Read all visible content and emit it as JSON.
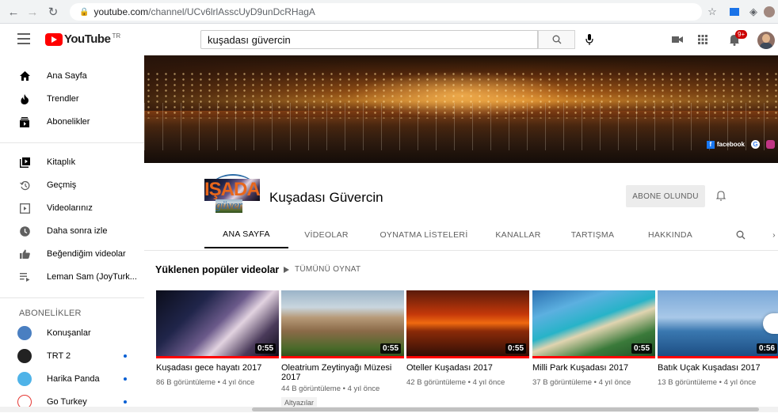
{
  "browser": {
    "url_host": "youtube.com",
    "url_path": "/channel/UCv6lrlAsscUyD9unDcRHagA"
  },
  "header": {
    "logo_text": "YouTube",
    "logo_region": "TR",
    "search_value": "kuşadası güvercin",
    "notification_count": "9+"
  },
  "sidebar": {
    "main_items": [
      {
        "label": "Ana Sayfa",
        "icon": "home-icon"
      },
      {
        "label": "Trendler",
        "icon": "fire-icon"
      },
      {
        "label": "Abonelikler",
        "icon": "subscriptions-icon"
      }
    ],
    "library_items": [
      {
        "label": "Kitaplık",
        "icon": "library-icon"
      },
      {
        "label": "Geçmiş",
        "icon": "history-icon"
      },
      {
        "label": "Videolarınız",
        "icon": "your-videos-icon"
      },
      {
        "label": "Daha sonra izle",
        "icon": "watch-later-icon"
      },
      {
        "label": "Beğendiğim videolar",
        "icon": "liked-icon"
      },
      {
        "label": "Leman Sam (JoyTurk...",
        "icon": "playlist-icon"
      }
    ],
    "subscriptions_heading": "ABONELİKLER",
    "subscriptions": [
      {
        "label": "Konuşanlar",
        "avatar_color": "#4a7fc1",
        "new": false
      },
      {
        "label": "TRT 2",
        "avatar_color": "#222222",
        "new": true
      },
      {
        "label": "Harika Panda",
        "avatar_color": "#4fb3e8",
        "new": true
      },
      {
        "label": "Go Turkey",
        "avatar_color": "#ffffff",
        "new": true
      }
    ]
  },
  "banner": {
    "facebook_label": "facebook"
  },
  "channel": {
    "logo_top": "IŞADA",
    "logo_bottom": "güver",
    "name": "Kuşadası Güvercin",
    "subscribe_label": "ABONE OLUNDU",
    "tabs": [
      "ANA SAYFA",
      "VİDEOLAR",
      "OYNATMA LİSTELERİ",
      "KANALLAR",
      "TARTIŞMA",
      "HAKKINDA"
    ]
  },
  "shelf": {
    "title": "Yüklenen popüler videolar",
    "play_all": "TÜMÜNÜ OYNAT",
    "videos": [
      {
        "title": "Kuşadası gece hayatı 2017",
        "meta": "86 B görüntüleme • 4 yıl önce",
        "duration": "0:55",
        "badge": ""
      },
      {
        "title": "Oleatrium Zeytinyağı Müzesi 2017",
        "meta": "44 B görüntüleme • 4 yıl önce",
        "duration": "0:55",
        "badge": "Altyazılar"
      },
      {
        "title": "Oteller Kuşadası 2017",
        "meta": "42 B görüntüleme • 4 yıl önce",
        "duration": "0:55",
        "badge": ""
      },
      {
        "title": "Milli Park Kuşadası 2017",
        "meta": "37 B görüntüleme • 4 yıl önce",
        "duration": "0:55",
        "badge": ""
      },
      {
        "title": "Batık Uçak Kuşadası 2017",
        "meta": "13 B görüntüleme • 4 yıl önce",
        "duration": "0:56",
        "badge": ""
      }
    ]
  }
}
